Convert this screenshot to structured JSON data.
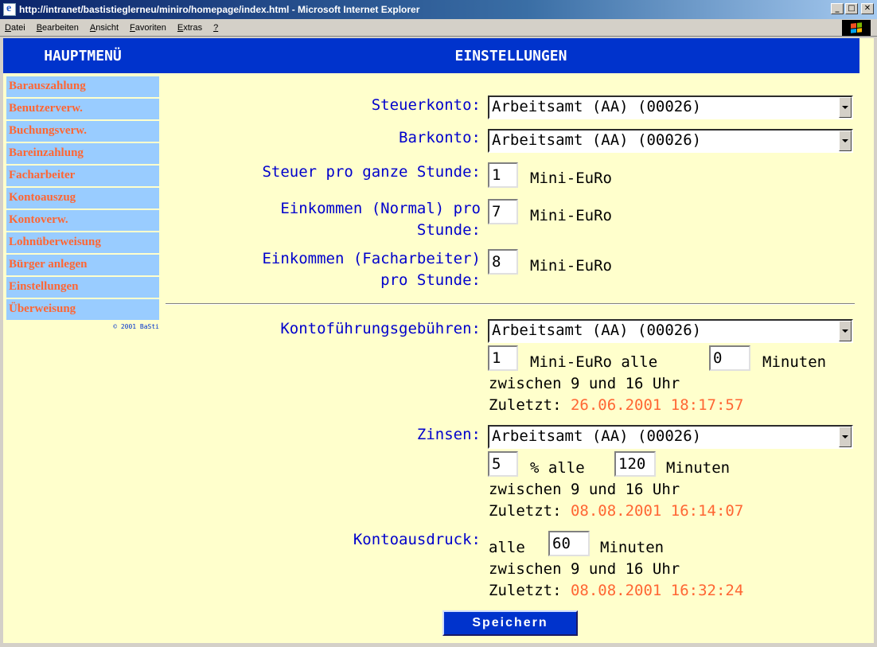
{
  "window": {
    "title": "http://intranet/bastistieglerneu/miniro/homepage/index.html - Microsoft Internet Explorer",
    "menu": [
      {
        "label": "Datei",
        "acc": "D",
        "rest": "atei"
      },
      {
        "label": "Bearbeiten",
        "acc": "B",
        "rest": "earbeiten"
      },
      {
        "label": "Ansicht",
        "acc": "A",
        "rest": "nsicht"
      },
      {
        "label": "Favoriten",
        "acc": "F",
        "rest": "avoriten"
      },
      {
        "label": "Extras",
        "acc": "E",
        "rest": "xtras"
      },
      {
        "label": "?",
        "acc": "?",
        "rest": ""
      }
    ]
  },
  "sidebar": {
    "header": "HAUPTMENÜ",
    "items": [
      {
        "label": "Barauszahlung"
      },
      {
        "label": "Benutzerverw."
      },
      {
        "label": "Buchungsverw."
      },
      {
        "label": "Bareinzahlung"
      },
      {
        "label": "Facharbeiter"
      },
      {
        "label": "Kontoauszug"
      },
      {
        "label": "Kontoverw."
      },
      {
        "label": "Lohnüberweisung"
      },
      {
        "label": "Bürger anlegen"
      },
      {
        "label": "Einstellungen"
      },
      {
        "label": "Überweisung"
      }
    ],
    "copyright": "© 2001 BaSti"
  },
  "main": {
    "header": "EINSTELLUNGEN",
    "steuerkonto": {
      "label": "Steuerkonto:",
      "value": "Arbeitsamt (AA) (00026)"
    },
    "barkonto": {
      "label": "Barkonto:",
      "value": "Arbeitsamt (AA) (00026)"
    },
    "steuer_stunde": {
      "label": "Steuer pro ganze Stunde:",
      "value": "1",
      "unit": "Mini-EuRo"
    },
    "einkommen_normal": {
      "label_line1": "Einkommen (Normal) pro",
      "label_line2": "Stunde:",
      "value": "7",
      "unit": "Mini-EuRo"
    },
    "einkommen_fach": {
      "label_line1": "Einkommen (Facharbeiter)",
      "label_line2": "pro Stunde:",
      "value": "8",
      "unit": "Mini-EuRo"
    },
    "kontofuehrung": {
      "label": "Kontoführungsgebühren:",
      "account": "Arbeitsamt (AA) (00026)",
      "amount": "1",
      "amount_text": "Mini-EuRo alle",
      "minutes": "0",
      "minutes_text": "Minuten",
      "window_text": "zwischen 9 und 16 Uhr",
      "last_label": "Zuletzt:",
      "last_value": "26.06.2001 18:17:57"
    },
    "zinsen": {
      "label": "Zinsen:",
      "account": "Arbeitsamt (AA) (00026)",
      "rate": "5",
      "rate_text": "% alle",
      "minutes": "120",
      "minutes_text": "Minuten",
      "window_text": "zwischen 9 und 16 Uhr",
      "last_label": "Zuletzt:",
      "last_value": "08.08.2001 16:14:07"
    },
    "kontoausdruck": {
      "label": "Kontoausdruck:",
      "prefix": "alle",
      "minutes": "60",
      "minutes_text": "Minuten",
      "window_text": "zwischen 9 und 16 Uhr",
      "last_label": "Zuletzt:",
      "last_value": "08.08.2001 16:32:24"
    },
    "save_label": "Speichern"
  }
}
